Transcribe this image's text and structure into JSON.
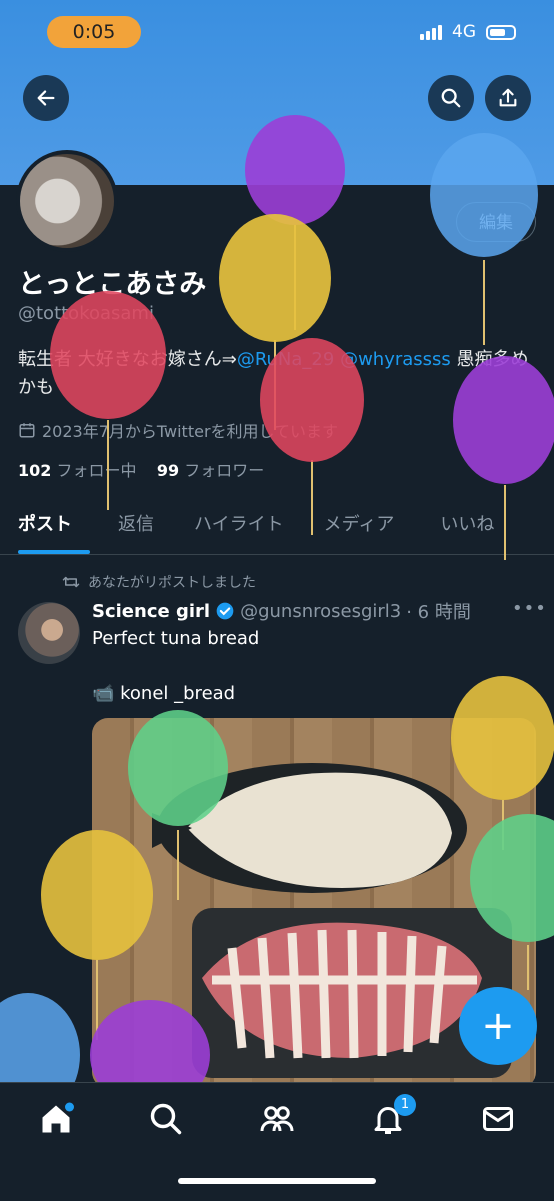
{
  "status_bar": {
    "timer": "0:05",
    "network": "4G"
  },
  "header": {
    "back": "back",
    "search": "search",
    "share": "share"
  },
  "profile": {
    "edit_label": "編集",
    "name": "とっとこあさみ",
    "handle": "@tottokoasami",
    "bio_text": "転生者 大好きなお嫁さん⇒",
    "bio_link1": "@RuNa_29",
    "bio_link2": "@whyrassss",
    "bio_suffix": "愚痴多めかも",
    "joined": "2023年7月からTwitterを利用しています",
    "following_count": "102",
    "following_label": "フォロー中",
    "followers_count": "99",
    "followers_label": "フォロワー"
  },
  "tabs": [
    "ポスト",
    "返信",
    "ハイライト",
    "メディア",
    "いいね"
  ],
  "post": {
    "repost_label": "あなたがリポストしました",
    "author": "Science girl",
    "handle": "@gunsnrosesgirl3",
    "time": "· 6 時間",
    "text": "Perfect tuna bread",
    "text2": "📹 konel _bread"
  },
  "fab_label": "+",
  "notification_badge": "1",
  "colors": {
    "accent": "#1d9bf0",
    "background": "#15202b",
    "banner": "#4a96e4"
  }
}
